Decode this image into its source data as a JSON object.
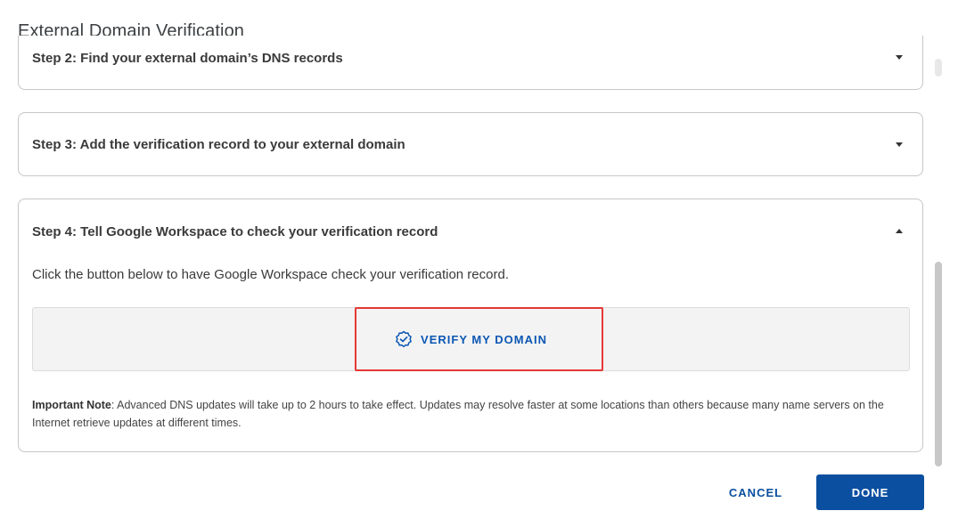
{
  "dialog": {
    "title": "External Domain Verification"
  },
  "steps": [
    {
      "label": "Step 2: Find your external domain’s DNS records",
      "expanded": false
    },
    {
      "label": "Step 3: Add the verification record to your external domain",
      "expanded": false
    },
    {
      "label": "Step 4: Tell Google Workspace to check your verification record",
      "expanded": true
    }
  ],
  "step4": {
    "description": "Click the button below to have Google Workspace check your verification record.",
    "verify_button": "VERIFY MY DOMAIN",
    "verify_icon": "verified-check-icon",
    "note_label": "Important Note",
    "note_text": ": Advanced DNS updates will take up to 2 hours to take effect. Updates may resolve faster at some locations than others because many name servers on the Internet retrieve updates at different times."
  },
  "footer": {
    "cancel": "CANCEL",
    "done": "DONE"
  },
  "colors": {
    "primary": "#0b4fa0",
    "highlight": "#e53935"
  }
}
